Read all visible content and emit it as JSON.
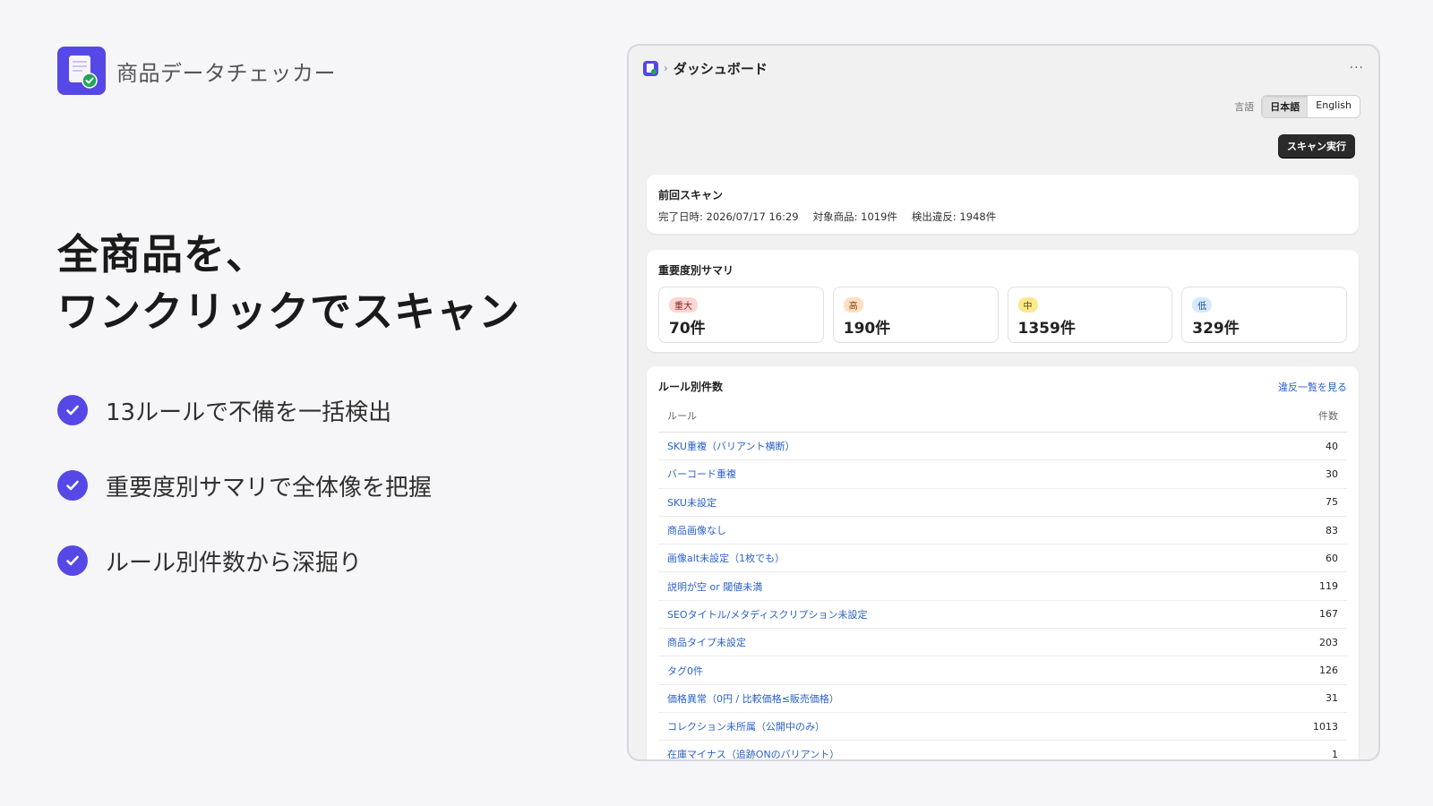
{
  "brand": {
    "name": "商品データチェッカー",
    "logo_icon": "document-check-icon",
    "accent": "#5548e6"
  },
  "headline": {
    "line1": "全商品を、",
    "line2": "ワンクリックでスキャン"
  },
  "features": [
    {
      "text": "13ルールで不備を一括検出",
      "icon": "check-circle-icon"
    },
    {
      "text": "重要度別サマリで全体像を把握",
      "icon": "check-circle-icon"
    },
    {
      "text": "ルール別件数から深掘り",
      "icon": "check-circle-icon"
    }
  ],
  "app": {
    "breadcrumb": "ダッシュボード",
    "more_icon": "more-horizontal-icon",
    "language": {
      "label": "言語",
      "options": [
        "日本語",
        "English"
      ],
      "selected": "日本語"
    },
    "scan_button": "スキャン実行",
    "last_scan": {
      "title": "前回スキャン",
      "completed": "完了日時: 2026/07/17 16:29",
      "products": "対象商品: 1019件",
      "violations": "検出違反: 1948件"
    },
    "summary": {
      "title": "重要度別サマリ",
      "items": [
        {
          "label": "重大",
          "count": "70件",
          "badge_bg": "#fbd6d2",
          "badge_fg": "#8c1d13"
        },
        {
          "label": "高",
          "count": "190件",
          "badge_bg": "#fde0c2",
          "badge_fg": "#7a3b06"
        },
        {
          "label": "中",
          "count": "1359件",
          "badge_bg": "#fbe98e",
          "badge_fg": "#5c4a00"
        },
        {
          "label": "低",
          "count": "329件",
          "badge_bg": "#d6e9fb",
          "badge_fg": "#1c4d7e"
        }
      ]
    },
    "rules": {
      "title": "ルール別件数",
      "link": "違反一覧を見る",
      "col_rule": "ルール",
      "col_count": "件数",
      "rows": [
        {
          "name": "SKU重複（バリアント横断）",
          "count": "40"
        },
        {
          "name": "バーコード重複",
          "count": "30"
        },
        {
          "name": "SKU未設定",
          "count": "75"
        },
        {
          "name": "商品画像なし",
          "count": "83"
        },
        {
          "name": "画像alt未設定（1枚でも）",
          "count": "60"
        },
        {
          "name": "説明が空 or 閾値未満",
          "count": "119"
        },
        {
          "name": "SEOタイトル/メタディスクリプション未設定",
          "count": "167"
        },
        {
          "name": "商品タイプ未設定",
          "count": "203"
        },
        {
          "name": "タグ0件",
          "count": "126"
        },
        {
          "name": "価格異常（0円 / 比較価格≤販売価格）",
          "count": "31"
        },
        {
          "name": "コレクション未所属（公開中のみ）",
          "count": "1013"
        },
        {
          "name": "在庫マイナス（追跡ONのバリアント）",
          "count": "1"
        }
      ]
    }
  }
}
